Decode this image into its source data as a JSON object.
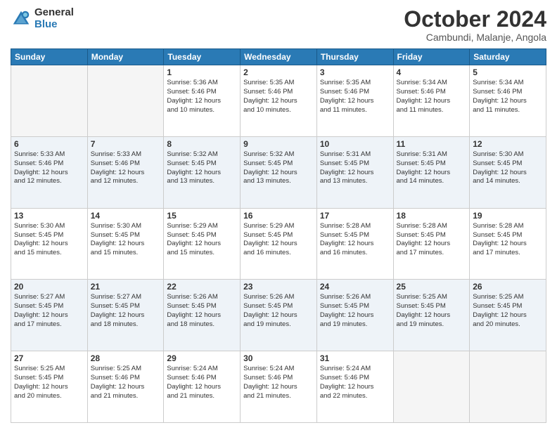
{
  "header": {
    "logo_general": "General",
    "logo_blue": "Blue",
    "month_title": "October 2024",
    "location": "Cambundi, Malanje, Angola"
  },
  "calendar": {
    "days_of_week": [
      "Sunday",
      "Monday",
      "Tuesday",
      "Wednesday",
      "Thursday",
      "Friday",
      "Saturday"
    ],
    "weeks": [
      [
        {
          "day": "",
          "info": ""
        },
        {
          "day": "",
          "info": ""
        },
        {
          "day": "1",
          "info": "Sunrise: 5:36 AM\nSunset: 5:46 PM\nDaylight: 12 hours\nand 10 minutes."
        },
        {
          "day": "2",
          "info": "Sunrise: 5:35 AM\nSunset: 5:46 PM\nDaylight: 12 hours\nand 10 minutes."
        },
        {
          "day": "3",
          "info": "Sunrise: 5:35 AM\nSunset: 5:46 PM\nDaylight: 12 hours\nand 11 minutes."
        },
        {
          "day": "4",
          "info": "Sunrise: 5:34 AM\nSunset: 5:46 PM\nDaylight: 12 hours\nand 11 minutes."
        },
        {
          "day": "5",
          "info": "Sunrise: 5:34 AM\nSunset: 5:46 PM\nDaylight: 12 hours\nand 11 minutes."
        }
      ],
      [
        {
          "day": "6",
          "info": "Sunrise: 5:33 AM\nSunset: 5:46 PM\nDaylight: 12 hours\nand 12 minutes."
        },
        {
          "day": "7",
          "info": "Sunrise: 5:33 AM\nSunset: 5:46 PM\nDaylight: 12 hours\nand 12 minutes."
        },
        {
          "day": "8",
          "info": "Sunrise: 5:32 AM\nSunset: 5:45 PM\nDaylight: 12 hours\nand 13 minutes."
        },
        {
          "day": "9",
          "info": "Sunrise: 5:32 AM\nSunset: 5:45 PM\nDaylight: 12 hours\nand 13 minutes."
        },
        {
          "day": "10",
          "info": "Sunrise: 5:31 AM\nSunset: 5:45 PM\nDaylight: 12 hours\nand 13 minutes."
        },
        {
          "day": "11",
          "info": "Sunrise: 5:31 AM\nSunset: 5:45 PM\nDaylight: 12 hours\nand 14 minutes."
        },
        {
          "day": "12",
          "info": "Sunrise: 5:30 AM\nSunset: 5:45 PM\nDaylight: 12 hours\nand 14 minutes."
        }
      ],
      [
        {
          "day": "13",
          "info": "Sunrise: 5:30 AM\nSunset: 5:45 PM\nDaylight: 12 hours\nand 15 minutes."
        },
        {
          "day": "14",
          "info": "Sunrise: 5:30 AM\nSunset: 5:45 PM\nDaylight: 12 hours\nand 15 minutes."
        },
        {
          "day": "15",
          "info": "Sunrise: 5:29 AM\nSunset: 5:45 PM\nDaylight: 12 hours\nand 15 minutes."
        },
        {
          "day": "16",
          "info": "Sunrise: 5:29 AM\nSunset: 5:45 PM\nDaylight: 12 hours\nand 16 minutes."
        },
        {
          "day": "17",
          "info": "Sunrise: 5:28 AM\nSunset: 5:45 PM\nDaylight: 12 hours\nand 16 minutes."
        },
        {
          "day": "18",
          "info": "Sunrise: 5:28 AM\nSunset: 5:45 PM\nDaylight: 12 hours\nand 17 minutes."
        },
        {
          "day": "19",
          "info": "Sunrise: 5:28 AM\nSunset: 5:45 PM\nDaylight: 12 hours\nand 17 minutes."
        }
      ],
      [
        {
          "day": "20",
          "info": "Sunrise: 5:27 AM\nSunset: 5:45 PM\nDaylight: 12 hours\nand 17 minutes."
        },
        {
          "day": "21",
          "info": "Sunrise: 5:27 AM\nSunset: 5:45 PM\nDaylight: 12 hours\nand 18 minutes."
        },
        {
          "day": "22",
          "info": "Sunrise: 5:26 AM\nSunset: 5:45 PM\nDaylight: 12 hours\nand 18 minutes."
        },
        {
          "day": "23",
          "info": "Sunrise: 5:26 AM\nSunset: 5:45 PM\nDaylight: 12 hours\nand 19 minutes."
        },
        {
          "day": "24",
          "info": "Sunrise: 5:26 AM\nSunset: 5:45 PM\nDaylight: 12 hours\nand 19 minutes."
        },
        {
          "day": "25",
          "info": "Sunrise: 5:25 AM\nSunset: 5:45 PM\nDaylight: 12 hours\nand 19 minutes."
        },
        {
          "day": "26",
          "info": "Sunrise: 5:25 AM\nSunset: 5:45 PM\nDaylight: 12 hours\nand 20 minutes."
        }
      ],
      [
        {
          "day": "27",
          "info": "Sunrise: 5:25 AM\nSunset: 5:45 PM\nDaylight: 12 hours\nand 20 minutes."
        },
        {
          "day": "28",
          "info": "Sunrise: 5:25 AM\nSunset: 5:46 PM\nDaylight: 12 hours\nand 21 minutes."
        },
        {
          "day": "29",
          "info": "Sunrise: 5:24 AM\nSunset: 5:46 PM\nDaylight: 12 hours\nand 21 minutes."
        },
        {
          "day": "30",
          "info": "Sunrise: 5:24 AM\nSunset: 5:46 PM\nDaylight: 12 hours\nand 21 minutes."
        },
        {
          "day": "31",
          "info": "Sunrise: 5:24 AM\nSunset: 5:46 PM\nDaylight: 12 hours\nand 22 minutes."
        },
        {
          "day": "",
          "info": ""
        },
        {
          "day": "",
          "info": ""
        }
      ]
    ]
  }
}
